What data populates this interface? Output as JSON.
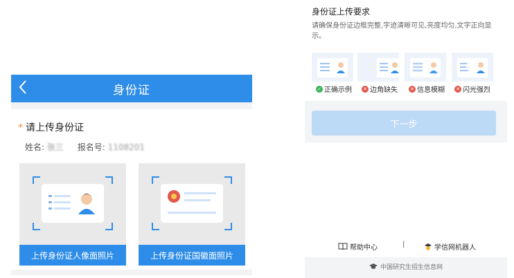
{
  "left": {
    "header_title": "身份证",
    "require_text": "请上传身份证",
    "required_mark": "*",
    "name_label": "姓名:",
    "name_value": "张三",
    "reg_label": "报名号:",
    "reg_value": "1108201",
    "upload_portrait_label": "上传身份证人像面照片",
    "upload_emblem_label": "上传身份证国徽面照片"
  },
  "right": {
    "section_title": "身份证上传要求",
    "section_desc": "请确保身份证边框完整,字迹清晰可见,亮度均匀,文字正向显示。",
    "examples": [
      {
        "label": "正确示例",
        "status": "ok"
      },
      {
        "label": "边角缺失",
        "status": "bad"
      },
      {
        "label": "信息模糊",
        "status": "bad"
      },
      {
        "label": "闪光强烈",
        "status": "bad"
      }
    ],
    "next_button": "下一步",
    "help_center": "帮助中心",
    "divider": "|",
    "robot": "学信网机器人",
    "footer": "中国研究生招生信息网"
  },
  "colors": {
    "primary": "#2e8de8",
    "button_disabled": "#bcd9f6",
    "ok": "#3cb35a",
    "bad": "#e2574c"
  }
}
